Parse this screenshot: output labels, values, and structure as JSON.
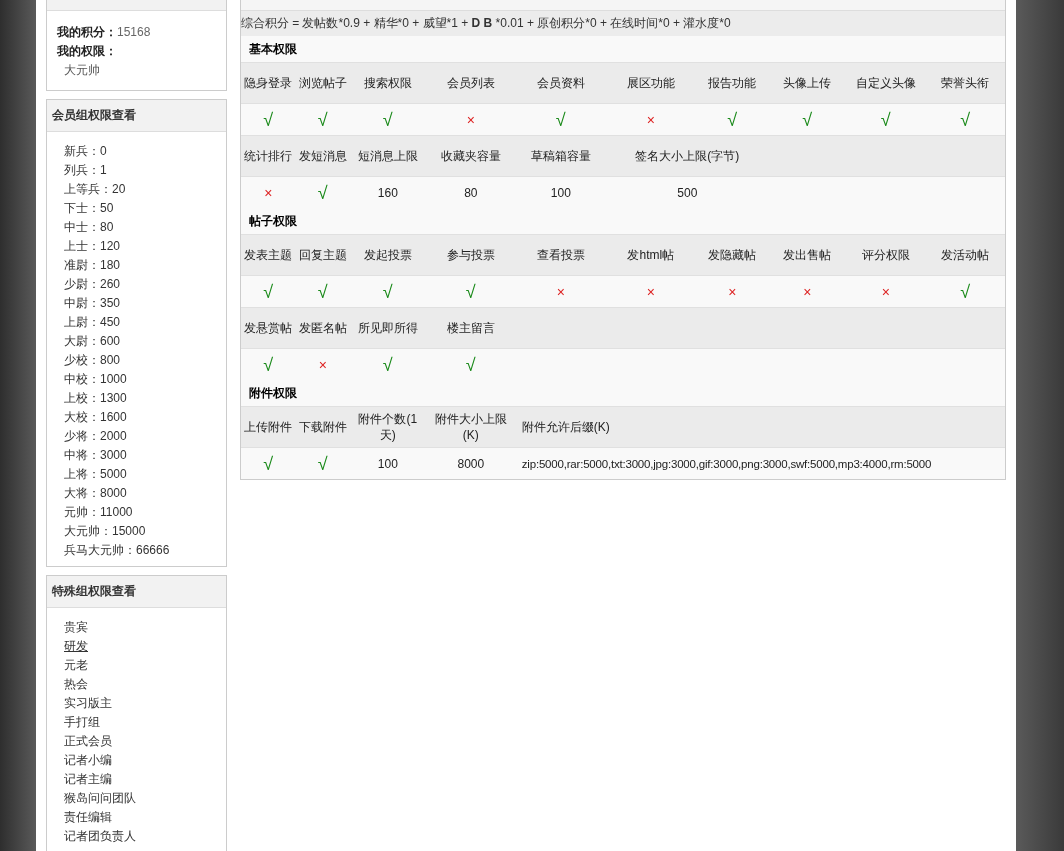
{
  "my_info": {
    "points_label": "我的积分：",
    "points": "15168",
    "rights_label": "我的权限：",
    "rights": "大元帅"
  },
  "member_groups": {
    "title": "会员组权限查看",
    "items": [
      "新兵：0",
      "列兵：1",
      "上等兵：20",
      "下士：50",
      "中士：80",
      "上士：120",
      "准尉：180",
      "少尉：260",
      "中尉：350",
      "上尉：450",
      "大尉：600",
      "少校：800",
      "中校：1000",
      "上校：1300",
      "大校：1600",
      "少将：2000",
      "中将：3000",
      "上将：5000",
      "大将：8000",
      "元帅：11000",
      "大元帅：15000",
      "兵马大元帅：66666"
    ]
  },
  "special_groups": {
    "title": "特殊组权限查看",
    "items": [
      {
        "label": "贵宾",
        "underlined": false
      },
      {
        "label": "研发",
        "underlined": true
      },
      {
        "label": "元老",
        "underlined": false
      },
      {
        "label": "热会",
        "underlined": false
      },
      {
        "label": "实习版主",
        "underlined": false
      },
      {
        "label": "手打组",
        "underlined": false
      },
      {
        "label": "正式会员",
        "underlined": false
      },
      {
        "label": "记者小编",
        "underlined": false
      },
      {
        "label": "记者主编",
        "underlined": false
      },
      {
        "label": "猴岛问问团队",
        "underlined": false
      },
      {
        "label": "责任编辑",
        "underlined": false
      },
      {
        "label": "记者团负责人",
        "underlined": false
      }
    ]
  },
  "formula": "综合积分 = 发帖数*0.9 + 精华*0 + 威望*1 + **D B** *0.01 + 原创积分*0 + 在线时间*0 + 灌水度*0",
  "sections": [
    {
      "title": "基本权限",
      "rows": [
        {
          "kind": "header",
          "cells": [
            {
              "text": "隐身登录"
            },
            {
              "text": "浏览帖子"
            },
            {
              "text": "搜索权限"
            },
            {
              "text": "会员列表"
            },
            {
              "text": "会员资料"
            },
            {
              "text": "展区功能"
            },
            {
              "text": "报告功能"
            },
            {
              "text": "头像上传"
            },
            {
              "text": "自定义头像"
            },
            {
              "text": "荣誉头衔"
            }
          ]
        },
        {
          "kind": "values",
          "cells": [
            {
              "kind": "yes",
              "text": "√"
            },
            {
              "kind": "yes",
              "text": "√"
            },
            {
              "kind": "yes",
              "text": "√"
            },
            {
              "kind": "no",
              "text": "×"
            },
            {
              "kind": "yes",
              "text": "√"
            },
            {
              "kind": "no",
              "text": "×"
            },
            {
              "kind": "yes",
              "text": "√"
            },
            {
              "kind": "yes",
              "text": "√"
            },
            {
              "kind": "yes",
              "text": "√"
            },
            {
              "kind": "yes",
              "text": "√"
            }
          ]
        },
        {
          "kind": "header",
          "cells": [
            {
              "text": "统计排行"
            },
            {
              "text": "发短消息"
            },
            {
              "text": "短消息上限"
            },
            {
              "text": "收藏夹容量"
            },
            {
              "text": "草稿箱容量"
            },
            {
              "text": "签名大小上限(字节)",
              "kind": "double"
            }
          ]
        },
        {
          "kind": "values",
          "cells": [
            {
              "kind": "no",
              "text": "×"
            },
            {
              "kind": "yes",
              "text": "√"
            },
            {
              "kind": "text",
              "text": "160"
            },
            {
              "kind": "text",
              "text": "80"
            },
            {
              "kind": "text",
              "text": "100"
            },
            {
              "kind": "text-double",
              "text": "500"
            }
          ]
        }
      ]
    },
    {
      "title": "帖子权限",
      "rows": [
        {
          "kind": "header",
          "cells": [
            {
              "text": "发表主题"
            },
            {
              "text": "回复主题"
            },
            {
              "text": "发起投票"
            },
            {
              "text": "参与投票"
            },
            {
              "text": "查看投票"
            },
            {
              "text": "发html帖"
            },
            {
              "text": "发隐藏帖"
            },
            {
              "text": "发出售帖"
            },
            {
              "text": "评分权限"
            },
            {
              "text": "发活动帖"
            }
          ]
        },
        {
          "kind": "values",
          "cells": [
            {
              "kind": "yes",
              "text": "√"
            },
            {
              "kind": "yes",
              "text": "√"
            },
            {
              "kind": "yes",
              "text": "√"
            },
            {
              "kind": "yes",
              "text": "√"
            },
            {
              "kind": "no",
              "text": "×"
            },
            {
              "kind": "no",
              "text": "×"
            },
            {
              "kind": "no",
              "text": "×"
            },
            {
              "kind": "no",
              "text": "×"
            },
            {
              "kind": "no",
              "text": "×"
            },
            {
              "kind": "yes",
              "text": "√"
            }
          ]
        },
        {
          "kind": "header",
          "cells": [
            {
              "text": "发悬赏帖"
            },
            {
              "text": "发匿名帖"
            },
            {
              "text": "所见即所得"
            },
            {
              "text": "楼主留言"
            }
          ]
        },
        {
          "kind": "values",
          "cells": [
            {
              "kind": "yes",
              "text": "√"
            },
            {
              "kind": "no",
              "text": "×"
            },
            {
              "kind": "yes",
              "text": "√"
            },
            {
              "kind": "yes",
              "text": "√"
            }
          ]
        }
      ]
    },
    {
      "title": "附件权限",
      "rows": [
        {
          "kind": "header",
          "cells": [
            {
              "text": "上传附件"
            },
            {
              "text": "下载附件"
            },
            {
              "text": "附件个数(1天)"
            },
            {
              "text": "附件大小上限(K)"
            },
            {
              "text": "附件允许后缀(K)",
              "kind": "wide"
            }
          ]
        },
        {
          "kind": "values",
          "cells": [
            {
              "kind": "yes",
              "text": "√"
            },
            {
              "kind": "yes",
              "text": "√"
            },
            {
              "kind": "text",
              "text": "100"
            },
            {
              "kind": "text",
              "text": "8000"
            },
            {
              "kind": "text-wide",
              "text": "zip:5000,rar:5000,txt:3000,jpg:3000,gif:3000,png:3000,swf:5000,mp3:4000,rm:5000"
            }
          ]
        }
      ]
    }
  ]
}
